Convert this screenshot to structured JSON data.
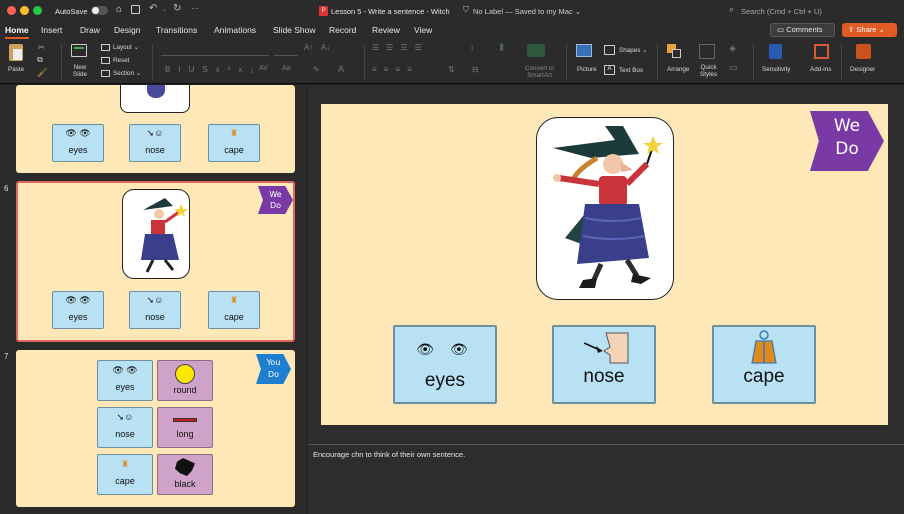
{
  "titlebar": {
    "autosave": "AutoSave",
    "doc_title": "Lesson 5 - Write a sentence - Witch",
    "label_status": "No Label — Saved to my Mac",
    "search_placeholder": "Search (Cmd + Ctrl + U)"
  },
  "tabs": [
    "Home",
    "Insert",
    "Draw",
    "Design",
    "Transitions",
    "Animations",
    "Slide Show",
    "Record",
    "Review",
    "View"
  ],
  "buttons": {
    "comments": "Comments",
    "share": "Share"
  },
  "ribbon": {
    "paste": "Paste",
    "new_slide": "New\nSlide",
    "layout": "Layout",
    "reset": "Reset",
    "section": "Section",
    "convert_smartart": "Convert to\nSmartArt",
    "picture": "Picture",
    "shapes": "Shapes",
    "text_box": "Text Box",
    "arrange": "Arrange",
    "quick_styles": "Quick\nStyles",
    "sensitivity": "Sensitivity",
    "add_ins": "Add-ins",
    "designer": "Designer"
  },
  "slides": {
    "s5": {
      "cards": [
        "eyes",
        "nose",
        "cape"
      ]
    },
    "s6": {
      "number": "6",
      "flag": "We\nDo",
      "cards": [
        "eyes",
        "nose",
        "cape"
      ]
    },
    "s7": {
      "number": "7",
      "flag": "You\nDo",
      "blue_cards": [
        "eyes",
        "nose",
        "cape"
      ],
      "purple_cards": [
        "round",
        "long",
        "black"
      ]
    }
  },
  "main_slide": {
    "flag_line1": "We",
    "flag_line2": "Do",
    "cards": [
      "eyes",
      "nose",
      "cape"
    ]
  },
  "notes": {
    "text": "Encourage chn to think of their own sentence."
  },
  "colors": {
    "accent": "#e15b25",
    "flag_purple": "#7a3aa6",
    "flag_blue": "#1f7fcf",
    "slide_bg": "#ffe8b8",
    "card_blue": "#b9e1f4",
    "card_purple": "#cfa3c9",
    "selected_border": "#e0675f"
  }
}
